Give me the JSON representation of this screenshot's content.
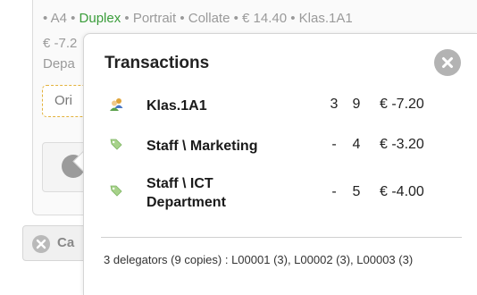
{
  "background": {
    "line1": {
      "pre": "• A4 • ",
      "duplex": "Duplex",
      "post": " • Portrait • Collate • € 14.40 • Klas.1A1"
    },
    "line2": "€ -7.2",
    "line3": "Depa",
    "dashed_button": "Ori",
    "cancel_label": "Ca"
  },
  "popup": {
    "title": "Transactions",
    "rows": [
      {
        "icon": "group-users-icon",
        "name": "Klas.1A1",
        "col1": "3",
        "col2": "9",
        "amount": "€ -7.20"
      },
      {
        "icon": "tag-icon",
        "name": "Staff \\ Marketing",
        "col1": "-",
        "col2": "4",
        "amount": "€ -3.20"
      },
      {
        "icon": "tag-icon",
        "name_line1": "Staff \\ ICT",
        "name_line2": "Department",
        "col1": "-",
        "col2": "5",
        "amount": "€ -4.00"
      }
    ],
    "footer": "3 delegators (9 copies) : L00001 (3), L00002 (3), L00003 (3)"
  },
  "colors": {
    "duplex": "#3a9d3a",
    "close_button": "#b3b3b3",
    "dashed_border": "#e3b23c"
  }
}
